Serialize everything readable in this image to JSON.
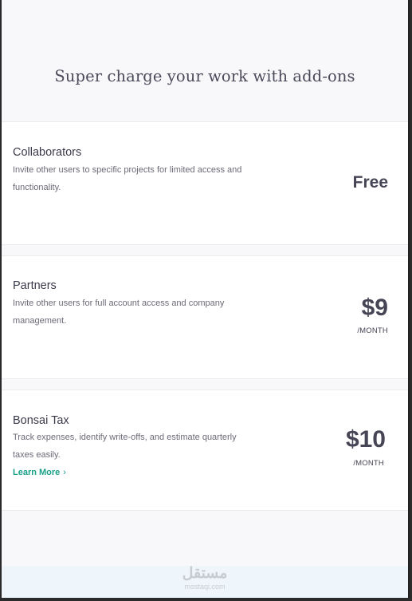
{
  "heading": "Super charge your work with add-ons",
  "addons": [
    {
      "title": "Collaborators",
      "description": "Invite other users to specific projects for limited access and functionality.",
      "price": "Free"
    },
    {
      "title": "Partners",
      "description": "Invite other users for full account access and company management.",
      "price": "$9",
      "period": "/MONTH"
    },
    {
      "title": "Bonsai Tax",
      "description": "Track expenses, identify write-offs, and estimate quarterly taxes easily.",
      "price": "$10",
      "period": "/MONTH",
      "link": "Learn More"
    }
  ],
  "watermark": {
    "main": "مستقل",
    "sub": "mostaqi.com"
  },
  "colors": {
    "accent": "#1aa18a",
    "page_bg": "#f8f8fa",
    "text": "#454555"
  }
}
